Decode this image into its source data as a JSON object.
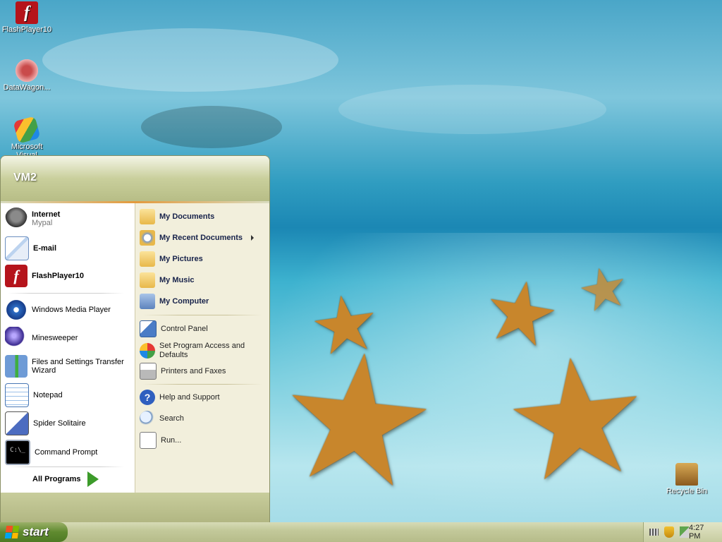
{
  "desktop": {
    "icons": [
      {
        "label": "FlashPlayer10",
        "icon": "flash-icon"
      },
      {
        "label": "DataWagon...",
        "icon": "datawagon-shortcut-icon"
      },
      {
        "label": "Microsoft Visual",
        "icon": "visual-studio-shortcut-icon"
      },
      {
        "label": "Recycle Bin",
        "icon": "recycle-bin-icon"
      }
    ]
  },
  "start_menu": {
    "user": "VM2",
    "pinned": [
      {
        "label": "Internet",
        "sublabel": "Mypal",
        "icon": "browser-icon"
      },
      {
        "label": "E-mail",
        "icon": "email-icon"
      },
      {
        "label": "FlashPlayer10",
        "icon": "flash-icon"
      }
    ],
    "recent": [
      {
        "label": "Windows Media Player",
        "icon": "media-player-icon"
      },
      {
        "label": "Minesweeper",
        "icon": "mine-icon"
      },
      {
        "label": "Files and Settings Transfer Wizard",
        "icon": "transfer-wizard-icon"
      },
      {
        "label": "Notepad",
        "icon": "notepad-icon"
      },
      {
        "label": "Spider Solitaire",
        "icon": "spider-icon"
      },
      {
        "label": "Command Prompt",
        "icon": "command-prompt-icon"
      }
    ],
    "all_programs": "All Programs",
    "right": {
      "my_documents": "My Documents",
      "my_recent_documents": "My Recent Documents",
      "my_pictures": "My Pictures",
      "my_music": "My Music",
      "my_computer": "My Computer",
      "control_panel": "Control Panel",
      "set_program_access": "Set Program Access and Defaults",
      "printers_faxes": "Printers and Faxes",
      "help_support": "Help and Support",
      "search": "Search",
      "run": "Run..."
    }
  },
  "taskbar": {
    "start_label": "start",
    "clock": "4:27 PM"
  }
}
